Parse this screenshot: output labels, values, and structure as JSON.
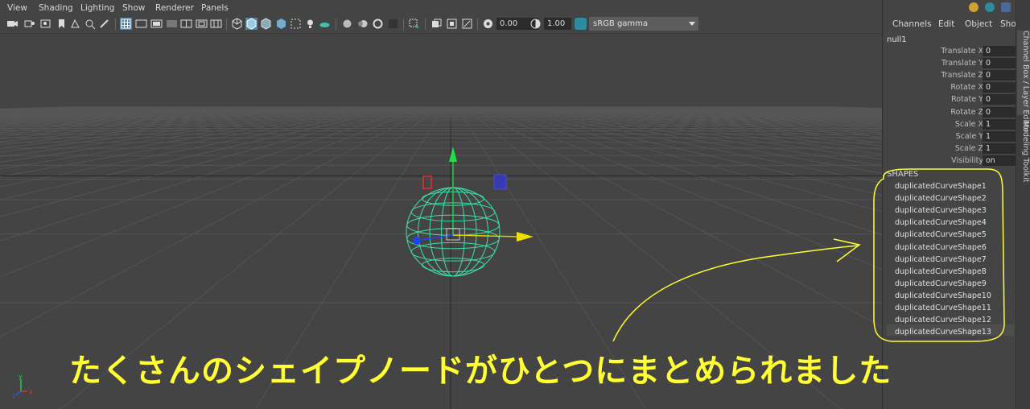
{
  "menubar": {
    "items": [
      "View",
      "Shading",
      "Lighting",
      "Show",
      "Renderer",
      "Panels"
    ]
  },
  "toolbar": {
    "exposure_value": "0.00",
    "gamma_value": "1.00",
    "color_space": "sRGB gamma"
  },
  "panel": {
    "menu": [
      "Channels",
      "Edit",
      "Object",
      "Show"
    ],
    "node_name": "null1",
    "attributes": [
      {
        "label": "Translate X",
        "value": "0"
      },
      {
        "label": "Translate Y",
        "value": "0"
      },
      {
        "label": "Translate Z",
        "value": "0"
      },
      {
        "label": "Rotate X",
        "value": "0"
      },
      {
        "label": "Rotate Y",
        "value": "0"
      },
      {
        "label": "Rotate Z",
        "value": "0"
      },
      {
        "label": "Scale X",
        "value": "1"
      },
      {
        "label": "Scale Y",
        "value": "1"
      },
      {
        "label": "Scale Z",
        "value": "1"
      },
      {
        "label": "Visibility",
        "value": "on"
      }
    ],
    "shapes_title": "SHAPES",
    "shapes": [
      "duplicatedCurveShape1",
      "duplicatedCurveShape2",
      "duplicatedCurveShape3",
      "duplicatedCurveShape4",
      "duplicatedCurveShape5",
      "duplicatedCurveShape6",
      "duplicatedCurveShape7",
      "duplicatedCurveShape8",
      "duplicatedCurveShape9",
      "duplicatedCurveShape10",
      "duplicatedCurveShape11",
      "duplicatedCurveShape12",
      "duplicatedCurveShape13"
    ],
    "side_tabs": [
      "Channel Box / Layer Editor",
      "Modeling Toolkit"
    ]
  },
  "axis_labels": {
    "y": "y",
    "x": "x",
    "z": "z"
  },
  "caption": "たくさんのシェイプノードがひとつにまとめられました",
  "colors": {
    "annotation": "#ffff33",
    "wire": "#3fe0a8",
    "panel_bg": "#444444"
  }
}
